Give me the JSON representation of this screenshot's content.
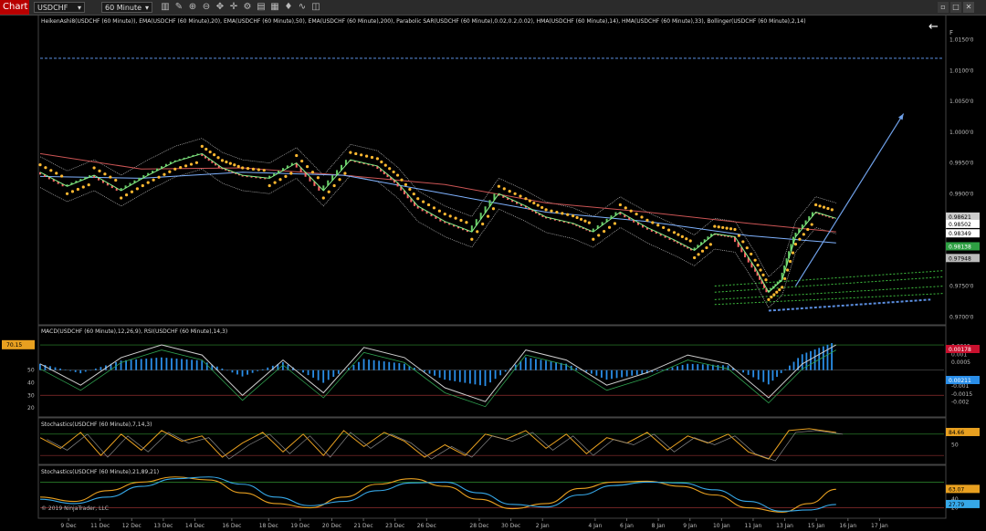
{
  "toolbar": {
    "tab_label": "Chart",
    "instrument": "USDCHF",
    "interval": "60 Minute",
    "icons": [
      "chart-style-icon",
      "drawing-tool-icon",
      "zoom-in-icon",
      "zoom-out-icon",
      "scroll-icon",
      "crosshair-icon",
      "properties-icon",
      "instrument-icon",
      "template-icon",
      "strategy-icon",
      "indicator-icon",
      "snapshot-icon"
    ]
  },
  "window_buttons": [
    "restore-icon",
    "maximize-icon",
    "close-icon"
  ],
  "colors": {
    "background": "#000000",
    "toolbar": "#2b2b2b",
    "tab": "#b80000",
    "ha_up": "#66cc66",
    "ha_down": "#ff6666",
    "ema20": "#7fb2ff",
    "ema200": "#cc5555",
    "sar": "#ffb830",
    "hma": "#88ee88",
    "bollinger": "#bbbbbb",
    "macd_hist": "#2a8ee8",
    "level_line": "#5b8ee0",
    "stoch_d": "#e8a020",
    "stoch_k": "#36a8e8"
  },
  "chart_data": [
    {
      "type": "line",
      "panel": "price",
      "title": "HeikenAshi8(USDCHF (60 Minute)), EMA(USDCHF (60 Minute),20), EMA(USDCHF (60 Minute),50), EMA(USDCHF (60 Minute),200), Parabolic SAR(USDCHF (60 Minute),0.02,0.2,0.02), HMA(USDCHF (60 Minute),14), HMA(USDCHF (60 Minute),33), Bollinger(USDCHF (60 Minute),2,14)",
      "ylim": [
        0.969,
        1.0185
      ],
      "y_ticks": [
        "1.0150'0",
        "1.0100'0",
        "1.0050'0",
        "1.0000'0",
        "0.9950'0",
        "0.9900'0",
        "0.9750'0",
        "0.9700'0"
      ],
      "y_tick_values": [
        1.015,
        1.01,
        1.005,
        1.0,
        0.995,
        0.99,
        0.975,
        0.97
      ],
      "partial_tick": "F",
      "price_labels": [
        {
          "text": "0.98621",
          "value": 0.98621,
          "color": "#cccccc"
        },
        {
          "text": "0.98502",
          "value": 0.98502,
          "color": "#ffffff"
        },
        {
          "text": "0.98349",
          "value": 0.98349,
          "color": "#ffffff"
        },
        {
          "text": "0.98138",
          "value": 0.98138,
          "color": "#2ea043"
        },
        {
          "text": "0.97948",
          "value": 0.97948,
          "color": "#bbbbbb"
        }
      ],
      "series": [
        {
          "name": "HeikenAshi8",
          "x": [
            0,
            4,
            8,
            12,
            16,
            20,
            24,
            27,
            30,
            34,
            38,
            42,
            46,
            50,
            53,
            56,
            60,
            64,
            68,
            72,
            75,
            79,
            82,
            86,
            90,
            94,
            97,
            100,
            103,
            106,
            108,
            110,
            112,
            115,
            118
          ],
          "values": [
            0.9935,
            0.9912,
            0.993,
            0.9905,
            0.993,
            0.9952,
            0.9965,
            0.9942,
            0.993,
            0.9925,
            0.995,
            0.9905,
            0.9955,
            0.9945,
            0.9918,
            0.988,
            0.9855,
            0.9838,
            0.99,
            0.988,
            0.9862,
            0.9852,
            0.9838,
            0.987,
            0.9845,
            0.9825,
            0.9808,
            0.9835,
            0.983,
            0.978,
            0.974,
            0.976,
            0.983,
            0.987,
            0.986
          ]
        },
        {
          "name": "EMA 200",
          "x": [
            0,
            15,
            30,
            45,
            60,
            75,
            90,
            105,
            118
          ],
          "values": [
            0.9965,
            0.994,
            0.9942,
            0.993,
            0.9915,
            0.9885,
            0.987,
            0.9852,
            0.9838
          ]
        },
        {
          "name": "EMA 50",
          "x": [
            0,
            15,
            30,
            45,
            60,
            75,
            90,
            105,
            118
          ],
          "values": [
            0.9928,
            0.9925,
            0.9935,
            0.993,
            0.99,
            0.987,
            0.9855,
            0.9832,
            0.982
          ]
        }
      ],
      "annotations": {
        "horizontal_level": 1.012,
        "arrow": {
          "from": [
            112,
            0.975
          ],
          "to": [
            128,
            1.003
          ]
        },
        "bottom_channel": {
          "from": [
            108,
            0.971
          ],
          "to": [
            132,
            0.9728
          ]
        },
        "green_fan": [
          [
            0.975,
            0.9775
          ],
          [
            0.974,
            0.9765
          ],
          [
            0.9728,
            0.975
          ],
          [
            0.972,
            0.9738
          ]
        ]
      },
      "x_max": 134
    },
    {
      "type": "bar",
      "panel": "macd_rsi",
      "title": "MACD(USDCHF (60 Minute),12,26,9), RSI(USDCHF (60 Minute),14,3)",
      "left_ticks": [
        "70",
        "50",
        "40",
        "30",
        "20"
      ],
      "left_tick_values": [
        70,
        50,
        40,
        30,
        20
      ],
      "left_badge": "70.15",
      "right_ticks": [
        "0.0015",
        "0.001",
        "0.0005",
        "-0.0005",
        "-0.001",
        "-0.0015",
        "-0.002"
      ],
      "right_tick_values": [
        0.0015,
        0.001,
        0.0005,
        -0.0005,
        -0.001,
        -0.0015,
        -0.002
      ],
      "right_labels": [
        {
          "text": "0.00178",
          "value": 0.00178,
          "color": "#c8102e"
        },
        {
          "text": "0.00211",
          "value": 0.00211,
          "color": "#2a8ee8"
        }
      ],
      "rsi_ylim": [
        15,
        78
      ],
      "series": [
        {
          "name": "MACD histogram",
          "x": [
            0,
            6,
            12,
            18,
            24,
            30,
            36,
            42,
            48,
            54,
            60,
            66,
            72,
            78,
            84,
            90,
            96,
            102,
            108,
            113,
            118
          ],
          "values": [
            0.0004,
            -0.0002,
            0.0006,
            0.0008,
            0.0006,
            -0.0004,
            0.0005,
            -0.0008,
            0.0007,
            0.0004,
            -0.0006,
            -0.001,
            0.0008,
            0.0004,
            -0.0006,
            -0.0002,
            0.0004,
            0.0003,
            -0.0009,
            0.001,
            0.0018
          ]
        },
        {
          "name": "RSI",
          "x": [
            0,
            6,
            12,
            18,
            24,
            30,
            36,
            42,
            48,
            54,
            60,
            66,
            72,
            78,
            84,
            90,
            96,
            102,
            108,
            113,
            118
          ],
          "values": [
            55,
            38,
            60,
            70,
            62,
            30,
            58,
            32,
            68,
            60,
            36,
            25,
            66,
            58,
            38,
            48,
            62,
            55,
            28,
            55,
            70
          ]
        }
      ]
    },
    {
      "type": "line",
      "panel": "stochastics_fast",
      "title": "Stochastics(USDCHF (60 Minute),7,14,3)",
      "y_ticks": [
        "50"
      ],
      "y_tick_values": [
        50
      ],
      "right_label": {
        "text": "84.66",
        "value": 84.66
      },
      "series": [
        {
          "name": "%K",
          "x": [
            0,
            3,
            6,
            9,
            12,
            15,
            18,
            21,
            24,
            27,
            30,
            33,
            36,
            39,
            42,
            45,
            48,
            51,
            54,
            57,
            60,
            63,
            66,
            69,
            72,
            75,
            78,
            81,
            84,
            87,
            90,
            93,
            96,
            99,
            102,
            105,
            108,
            111,
            114,
            118
          ],
          "values": [
            70,
            40,
            85,
            20,
            80,
            35,
            90,
            60,
            75,
            15,
            55,
            85,
            30,
            80,
            20,
            90,
            45,
            85,
            60,
            15,
            50,
            20,
            80,
            65,
            90,
            40,
            80,
            25,
            70,
            55,
            85,
            35,
            75,
            55,
            80,
            30,
            10,
            90,
            95,
            84.66
          ]
        }
      ]
    },
    {
      "type": "line",
      "panel": "stochastics_slow",
      "title": "Stochastics(USDCHF (60 Minute),21,89,21)",
      "y_ticks": [
        "40",
        "20"
      ],
      "y_tick_values": [
        40,
        20
      ],
      "right_labels": [
        {
          "text": "63.07",
          "value": 63.07,
          "color": "#e8a020"
        },
        {
          "text": "27.79",
          "value": 27.79,
          "color": "#36a8e8"
        }
      ],
      "series": [
        {
          "name": "%D",
          "x": [
            0,
            5,
            10,
            15,
            20,
            25,
            30,
            35,
            40,
            45,
            50,
            55,
            60,
            65,
            70,
            75,
            80,
            85,
            90,
            95,
            100,
            105,
            110,
            114,
            118
          ],
          "values": [
            45,
            35,
            60,
            80,
            92,
            85,
            55,
            30,
            20,
            45,
            75,
            88,
            70,
            40,
            18,
            30,
            65,
            80,
            82,
            70,
            50,
            20,
            10,
            30,
            63.07
          ]
        },
        {
          "name": "%K",
          "x": [
            0,
            5,
            10,
            15,
            20,
            25,
            30,
            35,
            40,
            45,
            50,
            55,
            60,
            65,
            70,
            75,
            80,
            85,
            90,
            95,
            100,
            105,
            110,
            114,
            118
          ],
          "values": [
            40,
            30,
            45,
            70,
            88,
            92,
            75,
            45,
            25,
            35,
            60,
            78,
            80,
            55,
            28,
            22,
            50,
            72,
            80,
            78,
            62,
            35,
            12,
            15,
            27.79
          ]
        }
      ],
      "copyright": "© 2019 NinjaTrader, LLC"
    }
  ],
  "x_axis": {
    "labels": [
      "9 Dec",
      "11 Dec",
      "12 Dec",
      "13 Dec",
      "14 Dec",
      "16 Dec",
      "18 Dec",
      "19 Dec",
      "20 Dec",
      "21 Dec",
      "23 Dec",
      "26 Dec",
      "28 Dec",
      "30 Dec",
      "2 Jan",
      "4 Jan",
      "6 Jan",
      "8 Jan",
      "9 Jan",
      "10 Jan",
      "11 Jan",
      "13 Jan",
      "15 Jan",
      "16 Jan",
      "17 Jan"
    ],
    "positions": [
      4,
      10,
      16,
      22,
      28,
      35,
      42,
      48,
      54,
      60,
      66,
      72,
      82,
      88,
      94,
      104,
      110,
      116,
      122,
      128,
      134,
      140,
      146,
      152,
      158
    ]
  }
}
